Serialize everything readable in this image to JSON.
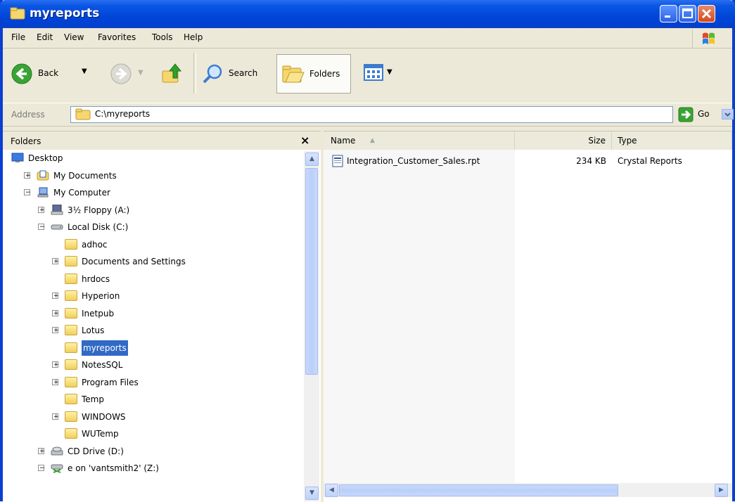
{
  "window": {
    "title": "myreports",
    "controls": {
      "minimize": "minimize",
      "maximize": "maximize",
      "close": "close"
    }
  },
  "menu": {
    "items": [
      "File",
      "Edit",
      "View",
      "Favorites",
      "Tools",
      "Help"
    ]
  },
  "toolbar": {
    "back_label": "Back",
    "search_label": "Search",
    "folders_label": "Folders"
  },
  "address": {
    "label": "Address",
    "value": "C:\\myreports",
    "go_label": "Go"
  },
  "folders_pane": {
    "title": "Folders",
    "close_glyph": "×",
    "tree": [
      {
        "label": "Desktop",
        "level": 0,
        "expander": "",
        "icon": "desktop-icon"
      },
      {
        "label": "My Documents",
        "level": 1,
        "expander": "+",
        "icon": "my-documents-icon"
      },
      {
        "label": "My Computer",
        "level": 1,
        "expander": "−",
        "icon": "my-computer-icon"
      },
      {
        "label": "3½ Floppy (A:)",
        "level": 2,
        "expander": "+",
        "icon": "floppy-icon"
      },
      {
        "label": "Local Disk (C:)",
        "level": 2,
        "expander": "−",
        "icon": "hard-disk-icon"
      },
      {
        "label": "adhoc",
        "level": 3,
        "expander": "",
        "icon": "folder-icon"
      },
      {
        "label": "Documents and Settings",
        "level": 3,
        "expander": "+",
        "icon": "folder-icon"
      },
      {
        "label": "hrdocs",
        "level": 3,
        "expander": "",
        "icon": "folder-icon"
      },
      {
        "label": "Hyperion",
        "level": 3,
        "expander": "+",
        "icon": "folder-icon"
      },
      {
        "label": "Inetpub",
        "level": 3,
        "expander": "+",
        "icon": "folder-icon"
      },
      {
        "label": "Lotus",
        "level": 3,
        "expander": "+",
        "icon": "folder-icon"
      },
      {
        "label": "myreports",
        "level": 3,
        "expander": "",
        "icon": "folder-icon",
        "selected": true
      },
      {
        "label": "NotesSQL",
        "level": 3,
        "expander": "+",
        "icon": "folder-icon"
      },
      {
        "label": "Program Files",
        "level": 3,
        "expander": "+",
        "icon": "folder-icon"
      },
      {
        "label": "Temp",
        "level": 3,
        "expander": "",
        "icon": "folder-icon"
      },
      {
        "label": "WINDOWS",
        "level": 3,
        "expander": "+",
        "icon": "folder-icon"
      },
      {
        "label": "WUTemp",
        "level": 3,
        "expander": "",
        "icon": "folder-icon"
      },
      {
        "label": "CD Drive (D:)",
        "level": 2,
        "expander": "+",
        "icon": "cd-drive-icon"
      },
      {
        "label": "e on 'vantsmith2' (Z:)",
        "level": 2,
        "expander": "−",
        "icon": "network-drive-icon"
      }
    ]
  },
  "file_list": {
    "columns": {
      "name": "Name",
      "size": "Size",
      "type": "Type"
    },
    "sort_indicator": "▲",
    "files": [
      {
        "name": "Integration_Customer_Sales.rpt",
        "size": "234 KB",
        "type": "Crystal Reports",
        "icon": "report-file-icon"
      }
    ]
  }
}
